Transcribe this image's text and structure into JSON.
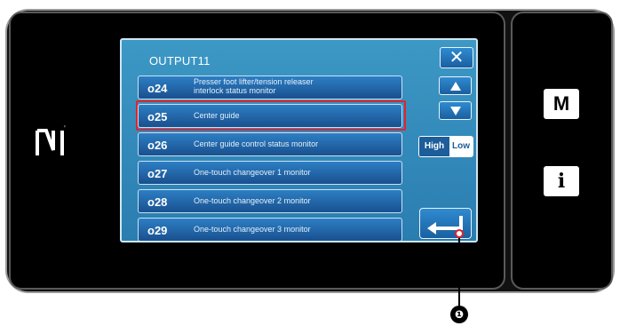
{
  "window": {
    "title": "OUTPUT11"
  },
  "rows": [
    {
      "code": "o24",
      "desc_line1": "Presser foot lifter/tension releaser",
      "desc_line2": "interlock status monitor"
    },
    {
      "code": "o25",
      "desc": "Center guide"
    },
    {
      "code": "o26",
      "desc": "Center guide control status monitor"
    },
    {
      "code": "o27",
      "desc": "One-touch changeover 1 monitor"
    },
    {
      "code": "o28",
      "desc": "One-touch changeover 2 monitor"
    },
    {
      "code": "o29",
      "desc": "One-touch changeover 3 monitor"
    }
  ],
  "buttons": {
    "close": "✕",
    "high": "High",
    "low": "Low"
  },
  "side_buttons": {
    "m": "M",
    "info": "i"
  },
  "callout": {
    "number": "❶"
  },
  "colors": {
    "screen": "#3d98c5",
    "row": "#2d7fc4",
    "highlight": "#e2232b",
    "bezel": "#000000"
  },
  "icons": [
    "nfc-icon",
    "close-icon",
    "scroll-up-icon",
    "scroll-down-icon",
    "enter-icon"
  ]
}
